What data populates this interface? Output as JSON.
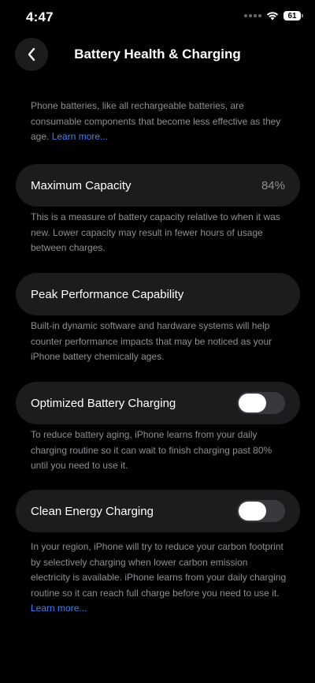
{
  "status_bar": {
    "time": "4:47",
    "battery_level": "61",
    "wifi_icon": "wifi-icon"
  },
  "nav": {
    "title": "Battery Health & Charging",
    "back_icon": "chevron-left-icon"
  },
  "intro": {
    "text": "Phone batteries, like all rechargeable batteries, are consumable components that become less effective as they age. ",
    "link": "Learn more..."
  },
  "max_capacity": {
    "label": "Maximum Capacity",
    "value": "84%",
    "footnote": "This is a measure of battery capacity relative to when it was new. Lower capacity may result in fewer hours of usage between charges."
  },
  "peak_performance": {
    "label": "Peak Performance Capability",
    "footnote": "Built-in dynamic software and hardware systems will help counter performance impacts that may be noticed as your iPhone battery chemically ages."
  },
  "optimized_charging": {
    "label": "Optimized Battery Charging",
    "enabled": false,
    "footnote": "To reduce battery aging, iPhone learns from your daily charging routine so it can wait to finish charging past 80% until you need to use it."
  },
  "clean_energy": {
    "label": "Clean Energy Charging",
    "enabled": false,
    "footnote": "In your region, iPhone will try to reduce your carbon footprint by selectively charging when lower carbon emission electricity is available. iPhone learns from your daily charging routine so it can reach full charge before you need to use it. ",
    "link": "Learn more..."
  },
  "colors": {
    "background": "#000000",
    "card": "#1c1c1e",
    "secondary_text": "#8e8e93",
    "link": "#3b82f6",
    "toggle_off": "#39393d"
  }
}
